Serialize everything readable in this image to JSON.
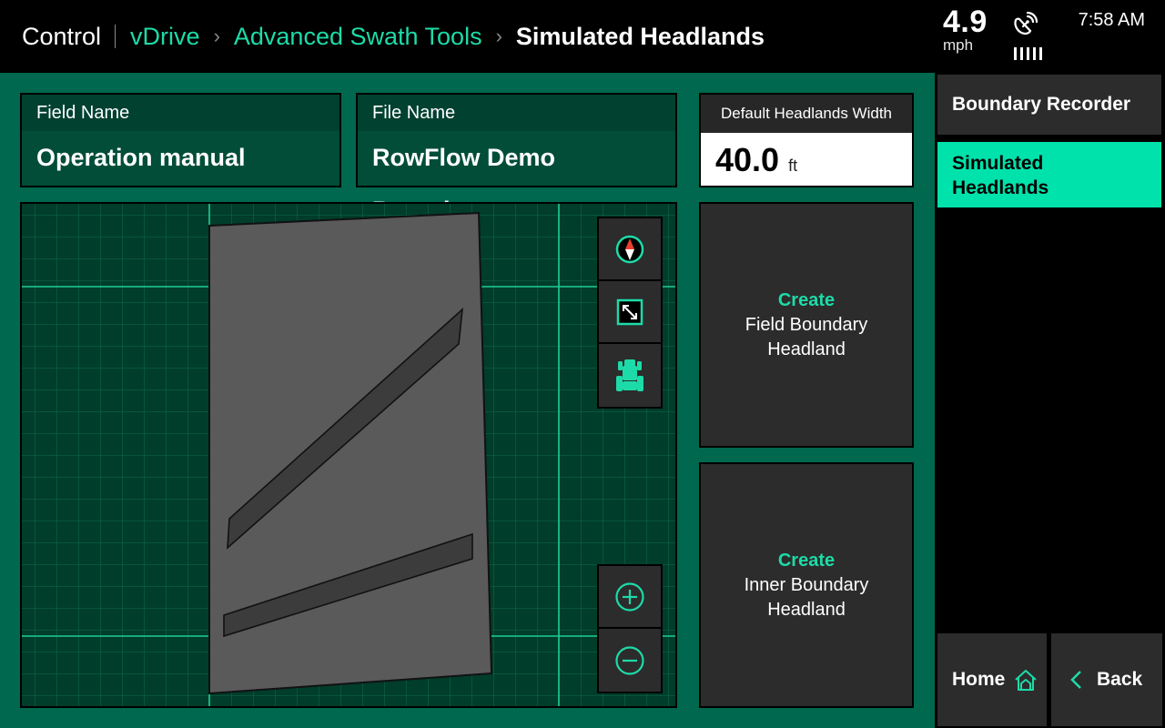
{
  "breadcrumb": {
    "root": "Control",
    "items": [
      "vDrive",
      "Advanced Swath Tools"
    ],
    "current": "Simulated Headlands"
  },
  "status": {
    "speed": "4.9",
    "speed_unit": "mph",
    "time": "7:58 AM",
    "gps_icon": "satellite-dish-icon"
  },
  "fields": {
    "field_name_label": "Field Name",
    "field_name_value": "Operation manual",
    "file_name_label": "File Name",
    "file_name_value": "RowFlow Demo Boundary",
    "width_label": "Default Headlands Width",
    "width_value": "40.0",
    "width_unit": "ft"
  },
  "map_controls": {
    "top": [
      "compass-icon",
      "fit-extents-icon",
      "tractor-icon"
    ],
    "zoom": [
      "zoom-in-icon",
      "zoom-out-icon"
    ]
  },
  "actions": {
    "field_boundary": {
      "create": "Create",
      "line1": "Field Boundary",
      "line2": "Headland"
    },
    "inner_boundary": {
      "create": "Create",
      "line1": "Inner Boundary",
      "line2": "Headland"
    }
  },
  "sidebar": {
    "items": [
      {
        "label": "Boundary Recorder",
        "active": false
      },
      {
        "label": "Simulated Headlands",
        "active": true
      }
    ],
    "home": "Home",
    "back": "Back"
  },
  "colors": {
    "accent": "#1ddba8",
    "active_tab": "#00e2ab",
    "background": "#00684e",
    "panel": "#2c2c2c",
    "map_bg": "#003d2b",
    "boundary": "#5a5a5a"
  }
}
